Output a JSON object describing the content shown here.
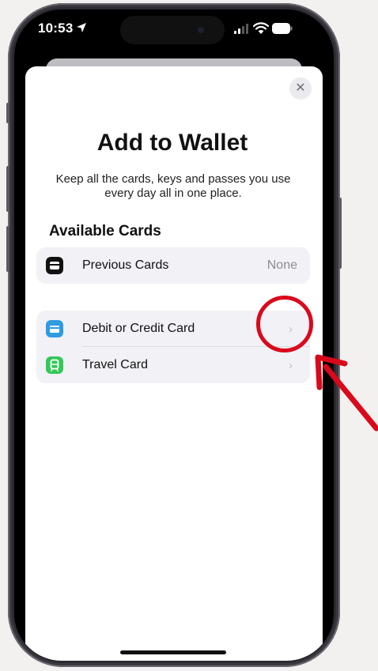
{
  "status_bar": {
    "time": "10:53"
  },
  "dialog": {
    "close_label": "✕",
    "title": "Add to Wallet",
    "subtitle": "Keep all the cards, keys and passes you use every day all in one place.",
    "section_header": "Available Cards"
  },
  "groups": [
    {
      "rows": [
        {
          "label": "Previous Cards",
          "value": "None",
          "icon": "wallet-icon",
          "icon_color": "#111111"
        }
      ]
    },
    {
      "rows": [
        {
          "label": "Debit or Credit Card",
          "chevron": "›",
          "icon": "credit-card-icon",
          "icon_color": "#2f9be0"
        },
        {
          "label": "Travel Card",
          "chevron": "›",
          "icon": "train-icon",
          "icon_color": "#34c759"
        }
      ]
    }
  ],
  "annotation": {
    "color": "#d9091c"
  }
}
